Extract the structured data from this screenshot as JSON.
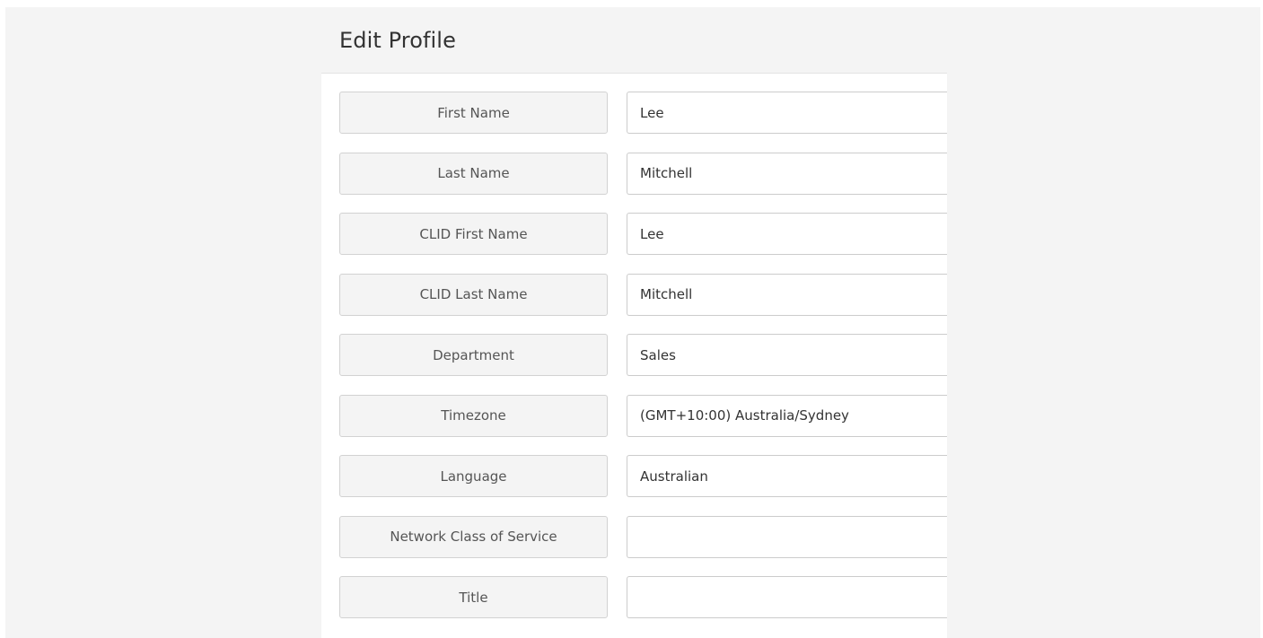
{
  "header": {
    "title": "Edit Profile"
  },
  "fields": [
    {
      "label": "First Name",
      "value": "Lee"
    },
    {
      "label": "Last Name",
      "value": "Mitchell"
    },
    {
      "label": "CLID First Name",
      "value": "Lee"
    },
    {
      "label": "CLID Last Name",
      "value": "Mitchell"
    },
    {
      "label": "Department",
      "value": "Sales"
    },
    {
      "label": "Timezone",
      "value": "(GMT+10:00) Australia/Sydney"
    },
    {
      "label": "Language",
      "value": "Australian"
    },
    {
      "label": "Network Class of Service",
      "value": ""
    },
    {
      "label": "Title",
      "value": ""
    }
  ],
  "colors": {
    "page_background": "#f4f4f4",
    "label_background": "#f4f4f4",
    "input_background": "#ffffff",
    "border": "#cccccc",
    "text": "#333333"
  }
}
